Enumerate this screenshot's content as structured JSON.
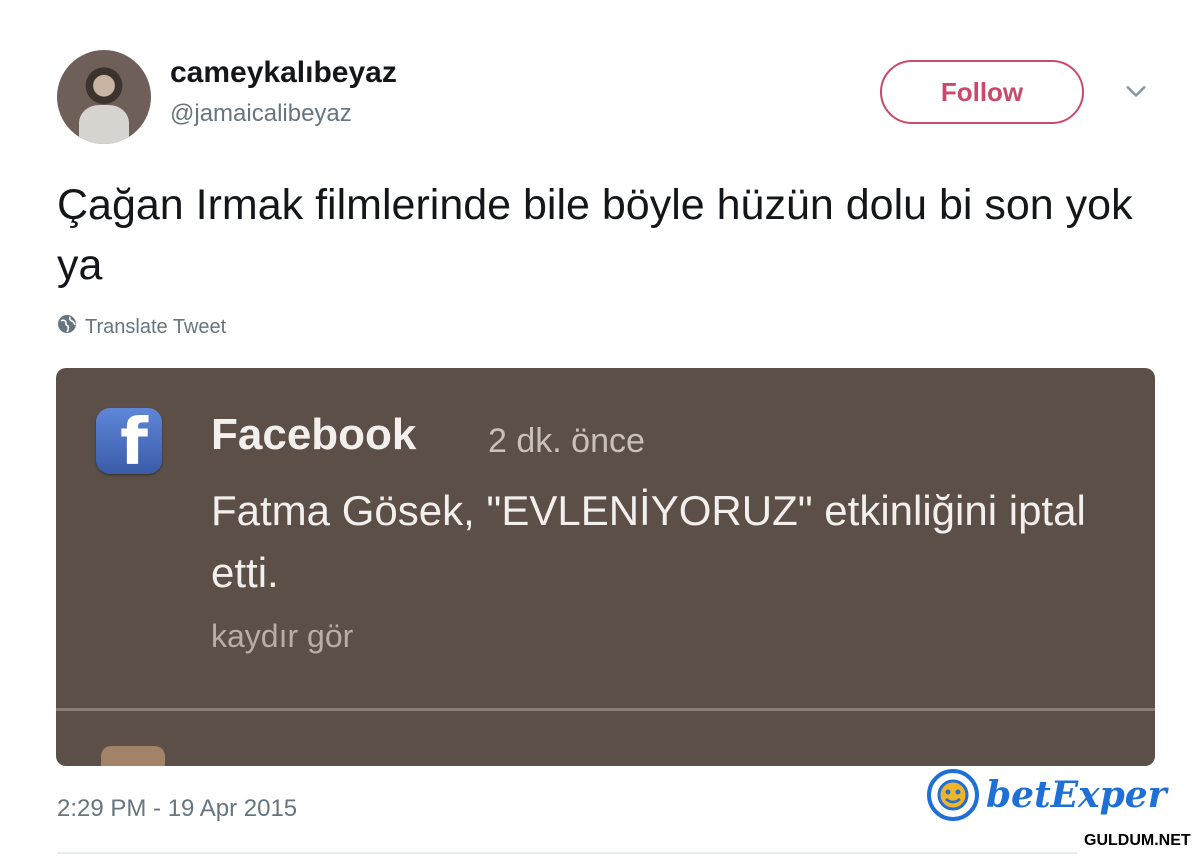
{
  "tweet": {
    "display_name": "cameykalıbeyaz",
    "handle": "@jamaicalibeyaz",
    "follow_label": "Follow",
    "text": "Çağan Irmak filmlerinde bile böyle hüzün dolu bi son yok ya",
    "translate_label": "Translate Tweet",
    "timestamp": "2:29 PM - 19 Apr 2015"
  },
  "notification": {
    "app_name": "Facebook",
    "time": "2 dk. önce",
    "body": "Fatma Gösek, \"EVLENİYORUZ\" etkinliğini iptal etti.",
    "action": "kaydır gör",
    "logo_glyph": "f"
  },
  "watermarks": {
    "betexper": "betExper",
    "guldum": "GULDUM.NET"
  },
  "icons": {
    "more": "chevron-down-icon",
    "translate": "globe-icon"
  },
  "colors": {
    "follow": "#c94a6b",
    "notification_bg": "#5b4f48",
    "facebook_blue": "#3a5ba8"
  }
}
